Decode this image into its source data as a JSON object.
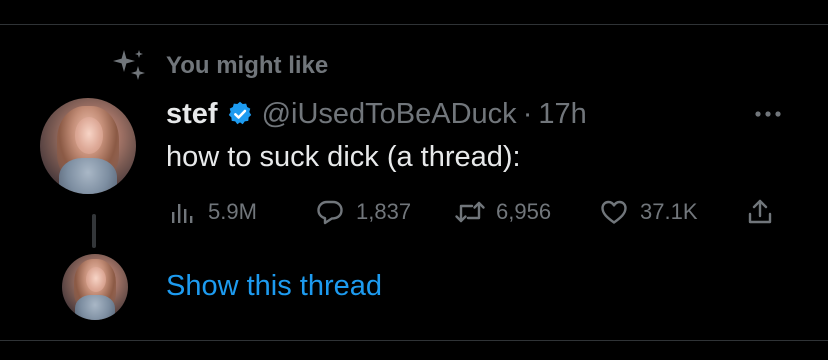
{
  "context": {
    "label": "You might like",
    "icon": "sparkle-icon"
  },
  "tweet": {
    "display_name": "stef",
    "handle": "@iUsedToBeADuck",
    "separator": "·",
    "timestamp": "17h",
    "verified": true,
    "text": "how to suck dick (a thread):",
    "stats": {
      "views": "5.9M",
      "replies": "1,837",
      "retweets": "6,956",
      "likes": "37.1K"
    }
  },
  "thread": {
    "show_label": "Show this thread"
  },
  "colors": {
    "background": "#000000",
    "text_primary": "#e7e9ea",
    "text_secondary": "#71767b",
    "accent": "#1d9bf0",
    "divider": "#2f3336"
  }
}
